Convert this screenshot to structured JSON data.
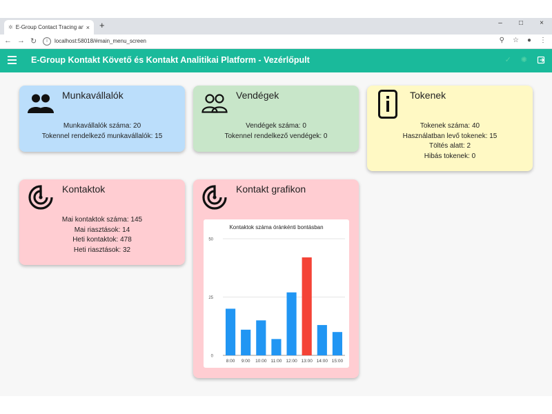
{
  "browser": {
    "tab_title": "E-Group Contact Tracing and Co",
    "tab_close": "×",
    "new_tab": "+",
    "url": "localhost:58018/#main_menu_screen",
    "win_min": "–",
    "win_max": "□",
    "win_close": "×"
  },
  "appbar": {
    "title": "E-Group Kontakt Követő és Kontakt Analitikai Platform - Vezérlőpult"
  },
  "cards": {
    "employees": {
      "title": "Munkavállalók",
      "lines": [
        "Munkavállalók száma: 20",
        "Tokennel rendelkező munkavállalók: 15"
      ]
    },
    "guests": {
      "title": "Vendégek",
      "lines": [
        "Vendégek száma: 0",
        "Tokennel rendelkező vendégek: 0"
      ]
    },
    "tokens": {
      "title": "Tokenek",
      "lines": [
        "Tokenek száma: 40",
        "Használatban levő tokenek: 15",
        "Töltés alatt: 2",
        "Hibás tokenek: 0"
      ]
    },
    "contacts": {
      "title": "Kontaktok",
      "lines": [
        "Mai kontaktok száma: 145",
        "Mai riasztások: 14",
        "Heti kontaktok: 478",
        "Heti riasztások: 32"
      ]
    },
    "graph": {
      "title": "Kontakt grafikon"
    }
  },
  "colors": {
    "appbar": "#1aba9b",
    "bar": "#2196f3",
    "bar_highlight": "#f44336"
  },
  "chart_data": {
    "type": "bar",
    "title": "Kontaktok száma óránkénti bontásban",
    "categories": [
      "8:00",
      "9:00",
      "10:00",
      "11:00",
      "12:00",
      "13:00",
      "14:00",
      "15:00"
    ],
    "values": [
      20,
      11,
      15,
      7,
      27,
      42,
      13,
      10
    ],
    "highlight_index": 5,
    "ylim": [
      0,
      50
    ],
    "yticks": [
      0,
      25,
      50
    ],
    "grid": true,
    "xlabel": "",
    "ylabel": ""
  }
}
